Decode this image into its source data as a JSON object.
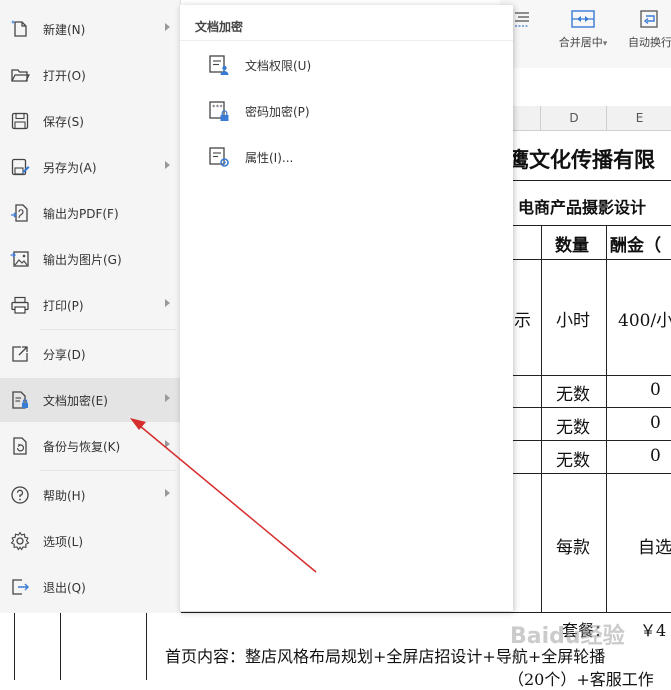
{
  "ribbon": {
    "merge_label": "合并居中",
    "merge_arrow": "▾",
    "wrap_label": "自动换行"
  },
  "columns": [
    "D",
    "E"
  ],
  "sheet": {
    "title": "鹰文化传播有限",
    "subtitle": "电商产品摄影设计",
    "header_qty": "数量",
    "header_fee": "酬金（",
    "row1_c": "示",
    "row1_qty": "小时",
    "row1_fee": "400/小",
    "row2_qty": "无数",
    "row2_fee": "0",
    "row3_qty": "无数",
    "row3_fee": "0",
    "row4_qty": "无数",
    "row4_fee": "0",
    "row5_qty": "每款",
    "row5_fee": "自选",
    "package_label": "套餐：",
    "package_price": "￥4",
    "bottom_line1": "首页内容：整店风格布局规划+全屏店招设计+导航+全屏轮播",
    "bottom_line2": "（20个）+客服工作"
  },
  "menu": {
    "items": [
      {
        "label": "新建(N)",
        "icon": "new-file-icon",
        "arrow": true
      },
      {
        "label": "打开(O)",
        "icon": "folder-open-icon",
        "arrow": false
      },
      {
        "label": "保存(S)",
        "icon": "save-icon",
        "arrow": false
      },
      {
        "label": "另存为(A)",
        "icon": "save-as-icon",
        "arrow": true
      },
      {
        "label": "输出为PDF(F)",
        "icon": "export-pdf-icon",
        "arrow": false
      },
      {
        "label": "输出为图片(G)",
        "icon": "export-image-icon",
        "arrow": false
      },
      {
        "label": "打印(P)",
        "icon": "printer-icon",
        "arrow": true
      },
      {
        "label": "分享(D)",
        "icon": "share-icon",
        "arrow": false
      },
      {
        "label": "文档加密(E)",
        "icon": "document-encrypt-icon",
        "arrow": true
      },
      {
        "label": "备份与恢复(K)",
        "icon": "backup-restore-icon",
        "arrow": true
      },
      {
        "label": "帮助(H)",
        "icon": "help-icon",
        "arrow": true
      },
      {
        "label": "选项(L)",
        "icon": "gear-icon",
        "arrow": false
      },
      {
        "label": "退出(Q)",
        "icon": "exit-icon",
        "arrow": false
      }
    ],
    "active_index": 8
  },
  "submenu": {
    "title": "文档加密",
    "items": [
      {
        "label": "文档权限(U)",
        "icon": "document-permission-icon"
      },
      {
        "label": "密码加密(P)",
        "icon": "password-encrypt-icon"
      },
      {
        "label": "属性(I)...",
        "icon": "properties-icon"
      }
    ]
  },
  "watermark": "Baidu经验",
  "colors": {
    "menu_bg": "#f5f5f5",
    "menu_active": "#e4e4e4",
    "icon_blue": "#2f6fd6",
    "arrow_red": "#d62d2d"
  }
}
